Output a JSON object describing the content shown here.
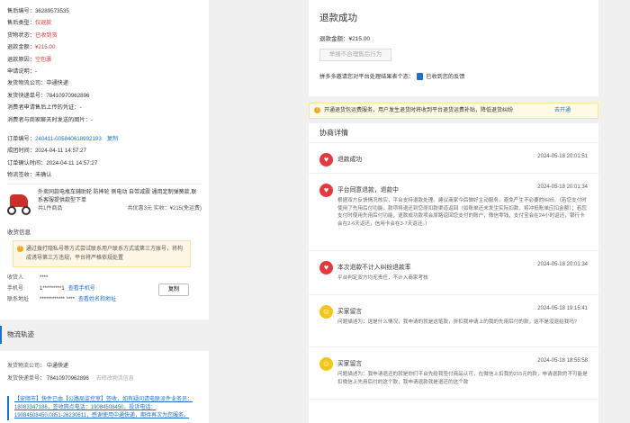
{
  "order_info": {
    "rows": [
      {
        "label": "售后编号：",
        "value": "36289573535",
        "tone": ""
      },
      {
        "label": "售后类型：",
        "value": "仅退款",
        "tone": "red"
      },
      {
        "label": "货物状态：",
        "value": "已收到货",
        "tone": "red"
      },
      {
        "label": "退款金额：",
        "value": "¥215.00",
        "tone": "red"
      },
      {
        "label": "退款原因：",
        "value": "空包裹",
        "tone": "red"
      },
      {
        "label": "申请说明：",
        "value": "-",
        "tone": ""
      },
      {
        "label": "发货物流公司：",
        "value": "中通快递",
        "tone": ""
      },
      {
        "label": "发货快递单号：",
        "value": "78410970962896",
        "tone": ""
      },
      {
        "label": "消费者申请售后上传的凭证：",
        "value": "-",
        "tone": ""
      },
      {
        "label": "消费者与商家聊天时发送的图片：",
        "value": "-",
        "tone": ""
      }
    ],
    "order_rows": [
      {
        "label": "订单编号：",
        "value": "240411-005840618992193",
        "link": "复制"
      },
      {
        "label": "成团时间：",
        "value": "2024-04-11 14:57:27",
        "link": ""
      },
      {
        "label": "订单确认时间：",
        "value": "2024-04-11 14:57:27",
        "link": ""
      },
      {
        "label": "物流签收：",
        "value": "未确认",
        "link": ""
      }
    ],
    "product": {
      "title": "外卖同款电瓶车辅助轮 防摔轮 侧电动 自带减震 通用定制弹簧款,联系客服提供款型下单",
      "count": "共1件商品",
      "total": "共优惠3元",
      "paid": "实收：¥215(免运费)"
    },
    "receiver": {
      "section_title": "收货信息",
      "warning": "通过拨打隐私号等方式尝试联系用户联系方式或第三方账号，将构成诱导第三方违规，平台将严格依规处置",
      "rows": [
        {
          "key": "收货人",
          "value": "****",
          "link": ""
        },
        {
          "key": "手机号",
          "value": "1*********1",
          "link": "查看手机号"
        },
        {
          "key": "联系地址",
          "value": "************ ****",
          "link": "查看姓名和地址"
        }
      ],
      "copy_label": "复制"
    }
  },
  "logistics": {
    "title": "物流轨迹",
    "company_label": "发货物流公司：",
    "company": "中通快递",
    "tracking_label": "发货快递单号：",
    "tracking": "78410970962896",
    "modify": "去修改物流信息",
    "track_text": "【安顺市】快件已由【公路局监控室】签收，如有疑问请电联派件业务员：18083347186，签收网点电话：19084508450，投诉电话：19084508450,0851-26230611，感谢使用中通快递，期待再次为您服务。"
  },
  "refund": {
    "title": "退款成功",
    "amount_label": "退款金额：",
    "amount": "¥215.00",
    "report_button": "举报不合理售后行为",
    "feedback_question": "拼多多邀请您对平台处理结果表个态：",
    "feedback_done": "已收到您的反馈"
  },
  "notice": {
    "text": "开通退货包运费服务，用户发生退货时将收到平台退货运费补贴，降低退货纠纷",
    "action": "去开通"
  },
  "negotiation": {
    "title": "协商详情",
    "events": [
      {
        "avatar": "heart",
        "title": "退款成功",
        "time": "2024-05-18 20:01:51",
        "body": ""
      },
      {
        "avatar": "heart",
        "title": "平台同意退款，退款中",
        "time": "2024-05-18 20:01:34",
        "body": "根据双方反馈情况核实，平台支持退款处理。建议商家今后做好主动服务，避免产生不必要的纠纷。（若您支付时使用了先用后付功能，款项将退还到您原扣款渠道返回（如账单还未发生实际扣款，将冲抵账单应扣金额）；若您支付时使用先用后付功能，退款成功款项会原路返回您支付的账户，微信零钱、支付宝会在24小时返还，银行卡会在2-6天返还，信用卡会在3-7天返还。）"
      },
      {
        "avatar": "heart",
        "title": "本次退款不计入纠纷退款率",
        "time": "2024-05-18 20:01:34",
        "body": "平台判定双方均无责任，不计入商家考核"
      },
      {
        "avatar": "user",
        "title": "买家留言",
        "time": "2024-05-18 19:15:41",
        "body": "问题描述为：这是什么情况，我申请的就是这笔款，折扣我申请上的我的先用后付的款，这不是没退给我吗?"
      },
      {
        "avatar": "user",
        "title": "买家留言",
        "time": "2024-05-18 18:55:58",
        "body": "问题描述为：我申请退还的就是你们平台先给我垫付商品认可，在微信上扣我的215元的款，申请退款的不可能是扣微信上先用后付的这个款，我申请退款就是退还的这个款"
      }
    ]
  },
  "colors": {
    "accent": "#1e6fce",
    "red": "#e4393c",
    "warning": "#f5a623"
  }
}
